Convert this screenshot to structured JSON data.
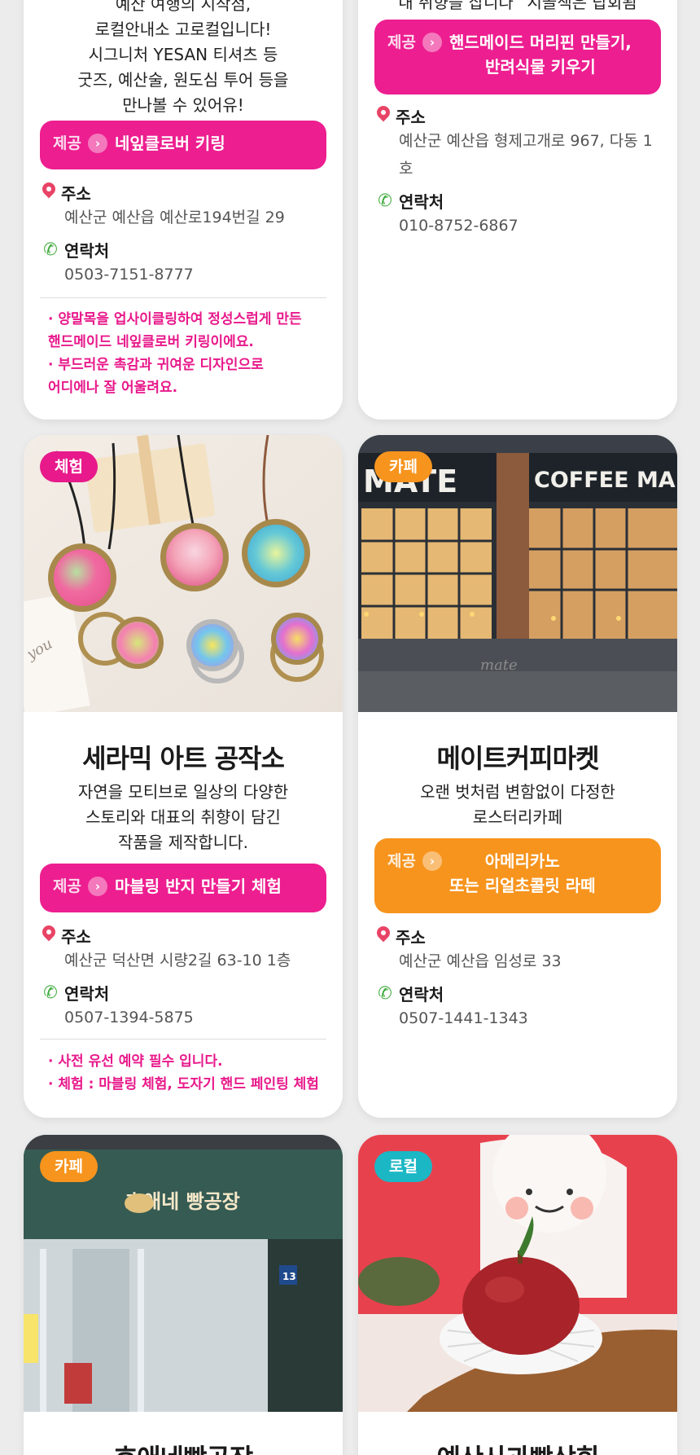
{
  "cards": {
    "c1": {
      "desc_lines": "예산 여행의 시작점,\n로컬안내소 고로컬입니다!\n시그니처 YESAN 티셔츠 등\n굿즈, 예산술, 원도심 투어 등을\n만나볼 수 있어유!",
      "offer_label": "제공",
      "offer": "네잎클로버 키링",
      "addr_label": "주소",
      "addr": "예산군 예산읍 예산로194번길 29",
      "contact_label": "연락처",
      "contact": "0503-7151-8777",
      "notes": [
        "· 양말목을 업사이클링하여 정성스럽게 만든\n  핸드메이드 네잎클로버 키링이에요.",
        "· 부드러운 촉감과 귀여운 디자인으로\n  어디에나 잘 어울려요."
      ]
    },
    "c2": {
      "desc_lines": "내 취향을 찹니다 “시골책은 탑회됨",
      "offer_label": "제공",
      "offer": "핸드메이드 머리핀 만들기,\n반려식물 키우기",
      "addr_label": "주소",
      "addr": "예산군 예산읍 형제고개로 967, 다동 1호",
      "contact_label": "연락처",
      "contact": "010-8752-6867"
    },
    "c3": {
      "badge": "체험",
      "title": "세라믹 아트 공작소",
      "desc_lines": "자연을 모티브로 일상의 다양한\n스토리와 대표의 취향이 담긴\n작품을 제작합니다.",
      "offer_label": "제공",
      "offer": "마블링 반지 만들기 체험",
      "addr_label": "주소",
      "addr": "예산군 덕산면 시량2길 63-10 1층",
      "contact_label": "연락처",
      "contact": "0507-1394-5875",
      "notes": [
        "· 사전 유선 예약 필수 입니다.",
        "· 체험 : 마블링 체험, 도자기 핸드 페인팅 체험"
      ],
      "card_text": "you"
    },
    "c4": {
      "badge": "카페",
      "title": "메이트커피마켓",
      "desc_lines": "오랜 벗처럼 변함없이 다정한\n로스터리카페",
      "offer_label": "제공",
      "offer": "아메리카노\n또는 리얼초콜릿 라떼",
      "addr_label": "주소",
      "addr": "예산군 예산읍 임성로 33",
      "contact_label": "연락처",
      "contact": "0507-1441-1343",
      "sign_left": "MATE",
      "sign_right": "COFFEE MARKET",
      "sign_small": "mate"
    },
    "c5": {
      "badge": "카페",
      "title": "효애네빵공장",
      "sign": "효애네 빵공장",
      "house_no": "13"
    },
    "c6": {
      "badge": "로컬",
      "title": "예산사과빵상회"
    }
  }
}
